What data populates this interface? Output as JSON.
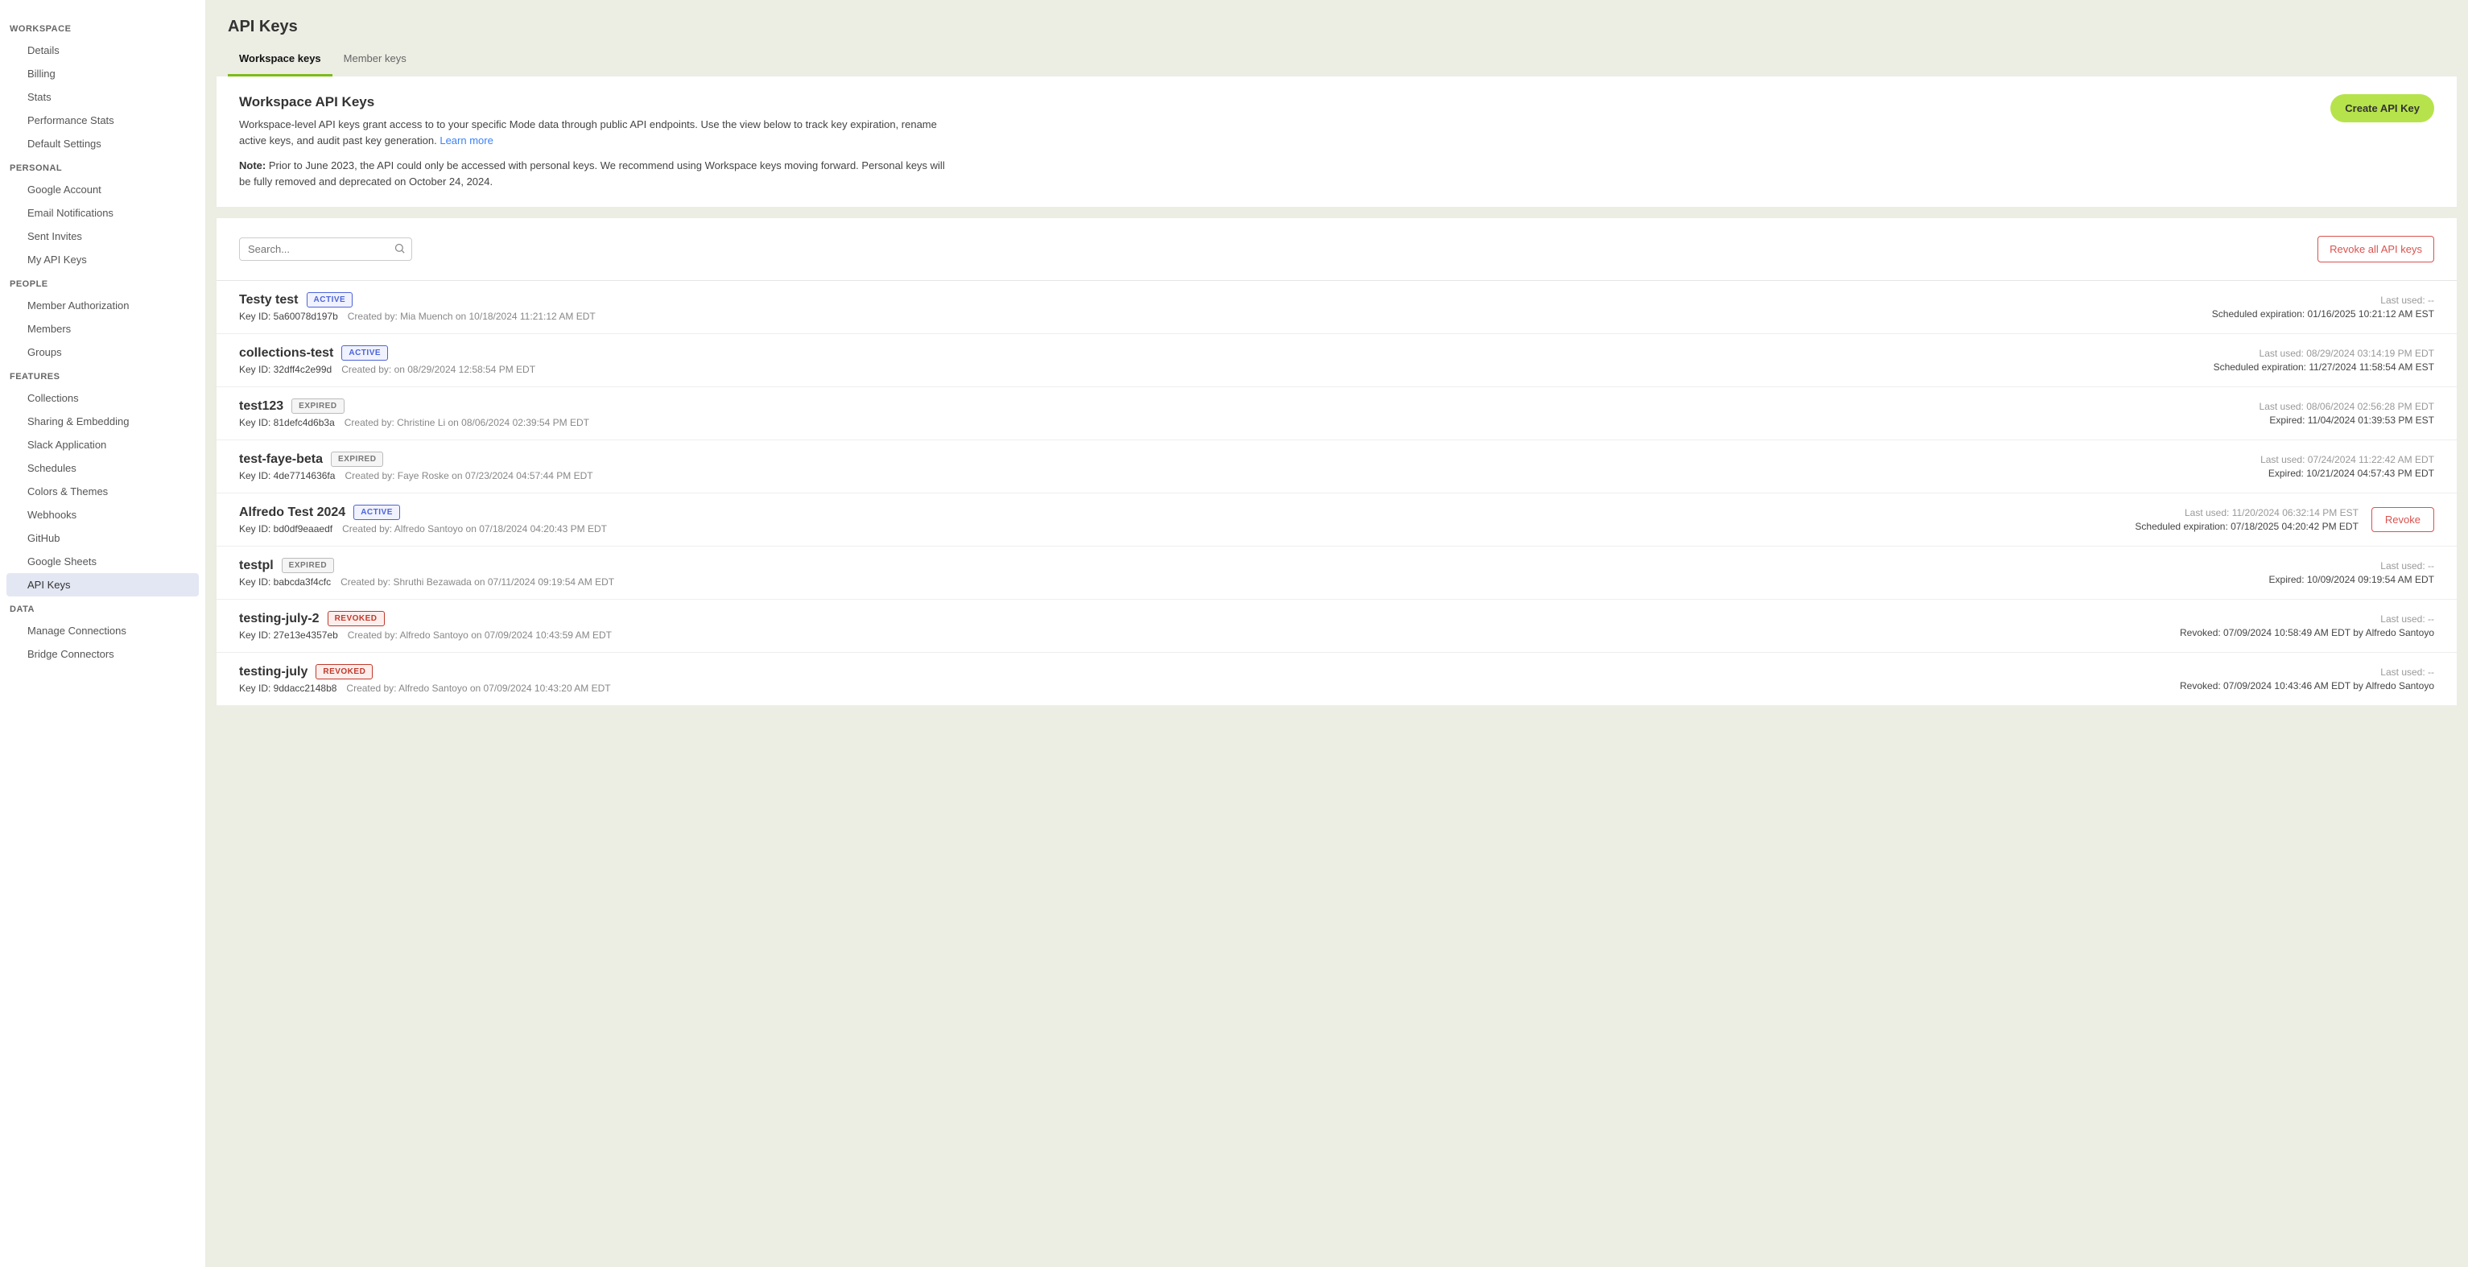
{
  "sidebar": {
    "sections": [
      {
        "header": "WORKSPACE",
        "items": [
          "Details",
          "Billing",
          "Stats",
          "Performance Stats",
          "Default Settings"
        ]
      },
      {
        "header": "PERSONAL",
        "items": [
          "Google Account",
          "Email Notifications",
          "Sent Invites",
          "My API Keys"
        ]
      },
      {
        "header": "PEOPLE",
        "items": [
          "Member Authorization",
          "Members",
          "Groups"
        ]
      },
      {
        "header": "FEATURES",
        "items": [
          "Collections",
          "Sharing & Embedding",
          "Slack Application",
          "Schedules",
          "Colors & Themes",
          "Webhooks",
          "GitHub",
          "Google Sheets",
          "API Keys"
        ]
      },
      {
        "header": "DATA",
        "items": [
          "Manage Connections",
          "Bridge Connectors"
        ]
      }
    ],
    "active_item": "API Keys"
  },
  "page": {
    "title": "API Keys",
    "tabs": [
      {
        "label": "Workspace keys",
        "active": true
      },
      {
        "label": "Member keys",
        "active": false
      }
    ],
    "section_title": "Workspace API Keys",
    "description": "Workspace-level API keys grant access to to your specific Mode data through public API endpoints. Use the view below to track key expiration, rename active keys, and audit past key generation.",
    "learn_more": "Learn more",
    "note_label": "Note:",
    "note_text": "Prior to June 2023, the API could only be accessed with personal keys. We recommend using Workspace keys moving forward. Personal keys will be fully removed and deprecated on October 24, 2024.",
    "create_button": "Create API Key",
    "search_placeholder": "Search...",
    "revoke_all_button": "Revoke all API keys",
    "revoke_button": "Revoke",
    "key_id_label": "Key ID:",
    "created_by_label": "Created by:",
    "last_used_label": "Last used:",
    "scheduled_label": "Scheduled expiration:",
    "expired_label": "Expired:",
    "revoked_label": "Revoked:"
  },
  "badges": {
    "ACTIVE": "ACTIVE",
    "EXPIRED": "EXPIRED",
    "REVOKED": "REVOKED"
  },
  "keys": [
    {
      "name": "Testy test",
      "status": "ACTIVE",
      "key_id": "5a60078d197b",
      "created_by": "Mia Muench on 10/18/2024 11:21:12 AM EDT",
      "last_used": "--",
      "status_line": "Scheduled expiration: 01/16/2025 10:21:12 AM EST",
      "show_revoke": false
    },
    {
      "name": "collections-test",
      "status": "ACTIVE",
      "key_id": "32dff4c2e99d",
      "created_by": "on 08/29/2024 12:58:54 PM EDT",
      "last_used": "08/29/2024 03:14:19 PM EDT",
      "status_line": "Scheduled expiration: 11/27/2024 11:58:54 AM EST",
      "show_revoke": false
    },
    {
      "name": "test123",
      "status": "EXPIRED",
      "key_id": "81defc4d6b3a",
      "created_by": "Christine Li on 08/06/2024 02:39:54 PM EDT",
      "last_used": "08/06/2024 02:56:28 PM EDT",
      "status_line": "Expired: 11/04/2024 01:39:53 PM EST",
      "show_revoke": false
    },
    {
      "name": "test-faye-beta",
      "status": "EXPIRED",
      "key_id": "4de7714636fa",
      "created_by": "Faye Roske on 07/23/2024 04:57:44 PM EDT",
      "last_used": "07/24/2024 11:22:42 AM EDT",
      "status_line": "Expired: 10/21/2024 04:57:43 PM EDT",
      "show_revoke": false
    },
    {
      "name": "Alfredo Test 2024",
      "status": "ACTIVE",
      "key_id": "bd0df9eaaedf",
      "created_by": "Alfredo Santoyo on 07/18/2024 04:20:43 PM EDT",
      "last_used": "11/20/2024 06:32:14 PM EST",
      "status_line": "Scheduled expiration: 07/18/2025 04:20:42 PM EDT",
      "show_revoke": true
    },
    {
      "name": "testpl",
      "status": "EXPIRED",
      "key_id": "babcda3f4cfc",
      "created_by": "Shruthi Bezawada on 07/11/2024 09:19:54 AM EDT",
      "last_used": "--",
      "status_line": "Expired: 10/09/2024 09:19:54 AM EDT",
      "show_revoke": false
    },
    {
      "name": "testing-july-2",
      "status": "REVOKED",
      "key_id": "27e13e4357eb",
      "created_by": "Alfredo Santoyo on 07/09/2024 10:43:59 AM EDT",
      "last_used": "--",
      "status_line": "Revoked: 07/09/2024 10:58:49 AM EDT by Alfredo Santoyo",
      "show_revoke": false
    },
    {
      "name": "testing-july",
      "status": "REVOKED",
      "key_id": "9ddacc2148b8",
      "created_by": "Alfredo Santoyo on 07/09/2024 10:43:20 AM EDT",
      "last_used": "--",
      "status_line": "Revoked: 07/09/2024 10:43:46 AM EDT by Alfredo Santoyo",
      "show_revoke": false
    }
  ]
}
